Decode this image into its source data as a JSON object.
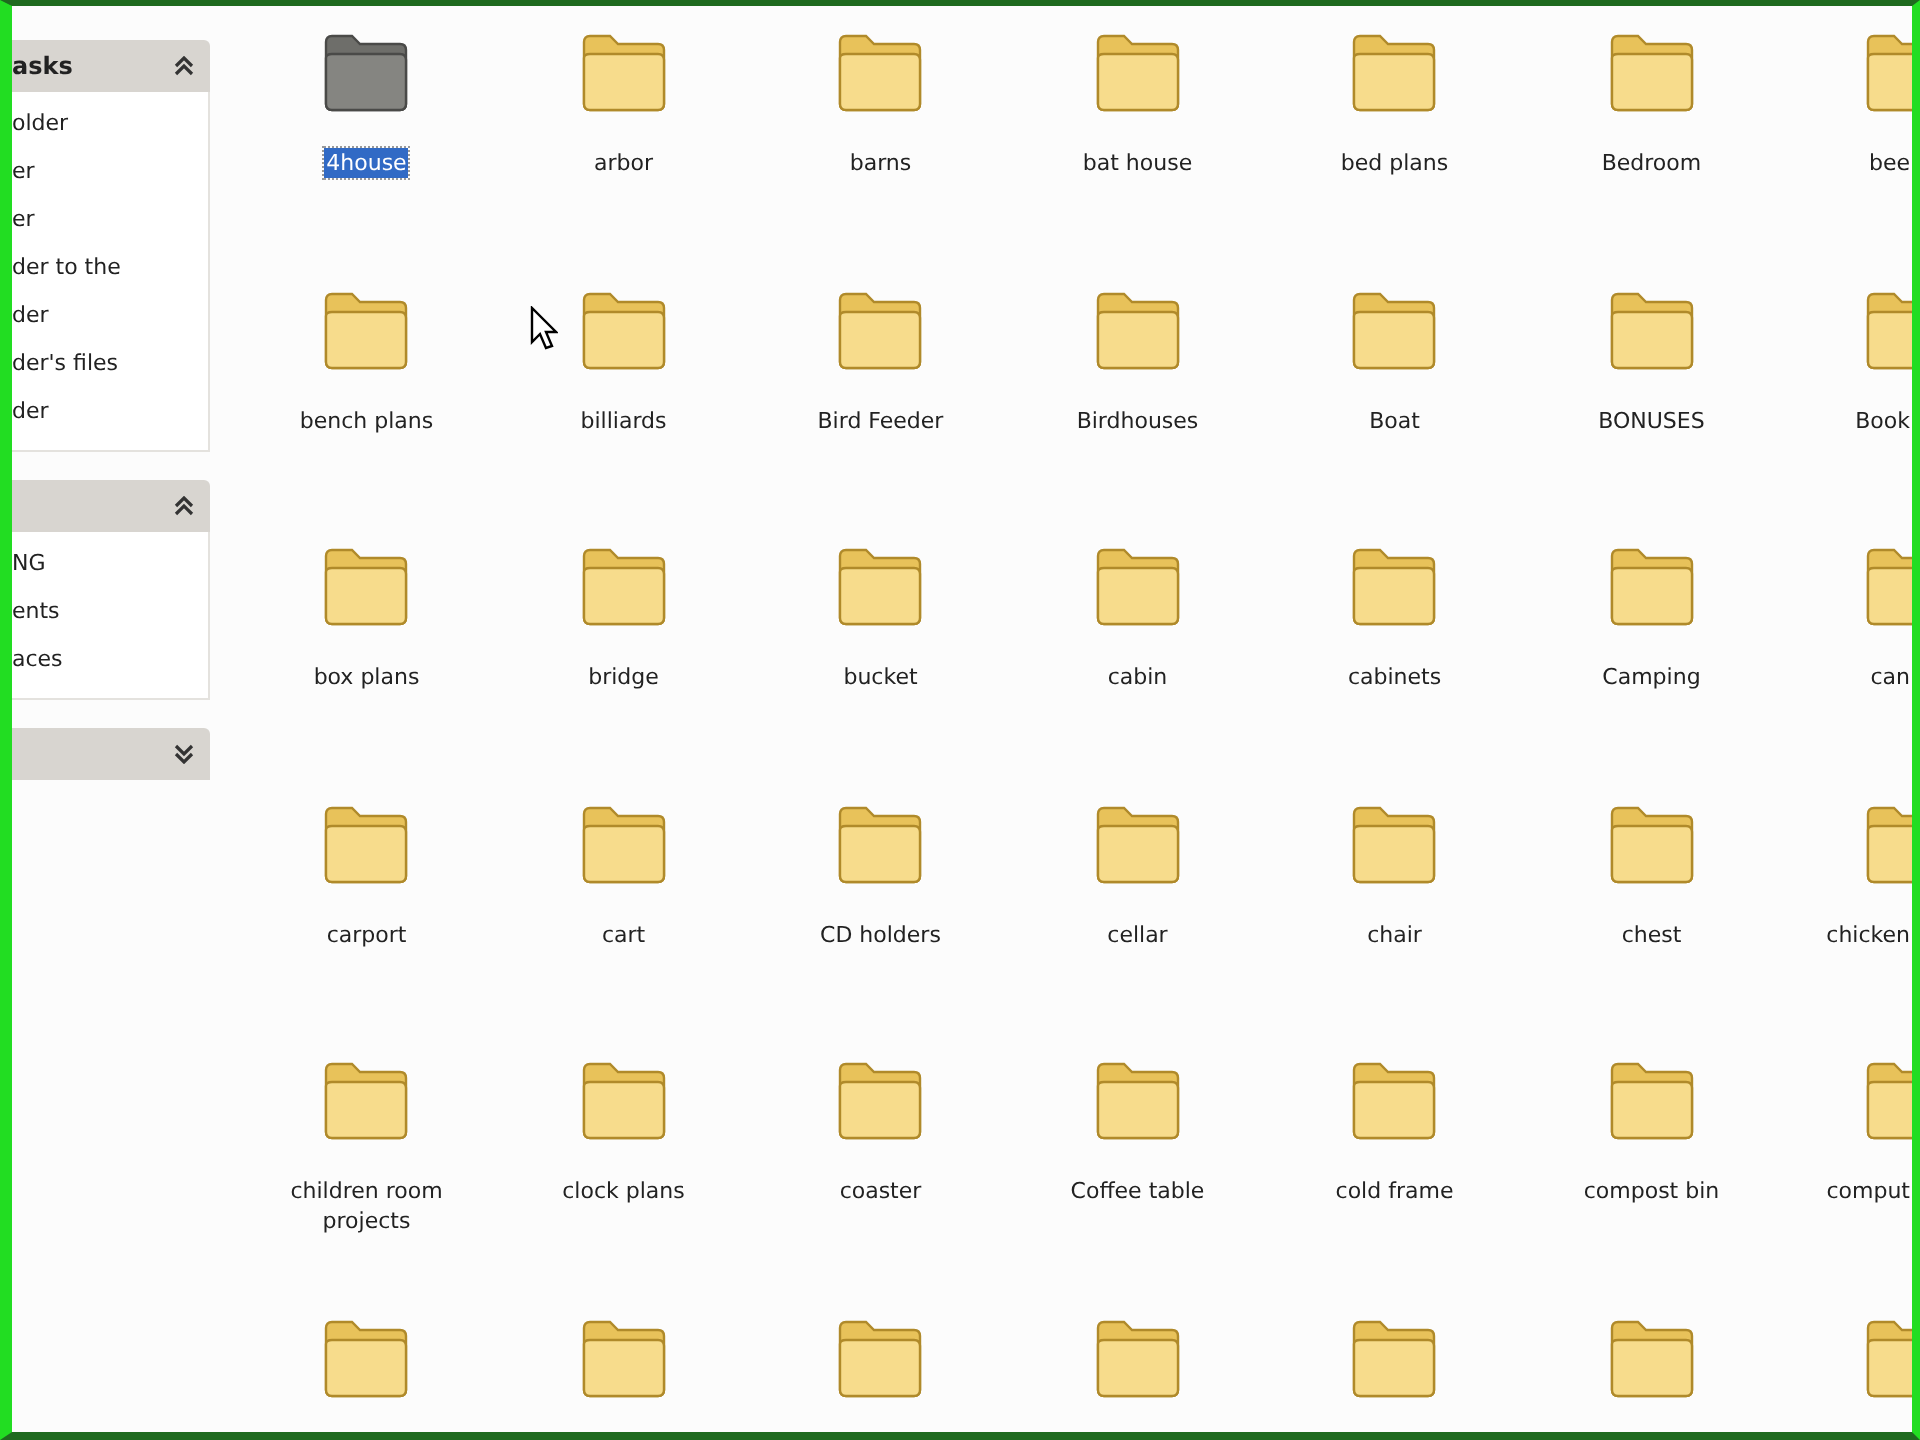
{
  "sidebar": {
    "panels": [
      {
        "title": "asks",
        "expanded": true,
        "items": [
          "older",
          "er",
          "er",
          "der to the",
          "der",
          "der's files",
          "der"
        ]
      },
      {
        "expanded": true,
        "items": [
          "NG",
          "ents",
          "aces"
        ]
      },
      {
        "expanded": false
      }
    ]
  },
  "folders": [
    {
      "label": "4house",
      "selected": true
    },
    {
      "label": "arbor",
      "selected": false
    },
    {
      "label": "barns",
      "selected": false
    },
    {
      "label": "bat house",
      "selected": false
    },
    {
      "label": "bed plans",
      "selected": false
    },
    {
      "label": "Bedroom",
      "selected": false
    },
    {
      "label": "bee",
      "selected": false
    },
    {
      "label": "bench plans",
      "selected": false
    },
    {
      "label": "billiards",
      "selected": false
    },
    {
      "label": "Bird Feeder",
      "selected": false
    },
    {
      "label": "Birdhouses",
      "selected": false
    },
    {
      "label": "Boat",
      "selected": false
    },
    {
      "label": "BONUSES",
      "selected": false
    },
    {
      "label": "Book",
      "selected": false
    },
    {
      "label": "box plans",
      "selected": false
    },
    {
      "label": "bridge",
      "selected": false
    },
    {
      "label": "bucket",
      "selected": false
    },
    {
      "label": "cabin",
      "selected": false
    },
    {
      "label": "cabinets",
      "selected": false
    },
    {
      "label": "Camping",
      "selected": false
    },
    {
      "label": "can",
      "selected": false
    },
    {
      "label": "carport",
      "selected": false
    },
    {
      "label": "cart",
      "selected": false
    },
    {
      "label": "CD holders",
      "selected": false
    },
    {
      "label": "cellar",
      "selected": false
    },
    {
      "label": "chair",
      "selected": false
    },
    {
      "label": "chest",
      "selected": false
    },
    {
      "label": "chicken",
      "selected": false
    },
    {
      "label": "children room projects",
      "selected": false
    },
    {
      "label": "clock plans",
      "selected": false
    },
    {
      "label": "coaster",
      "selected": false
    },
    {
      "label": "Coffee table",
      "selected": false
    },
    {
      "label": "cold frame",
      "selected": false
    },
    {
      "label": "compost bin",
      "selected": false
    },
    {
      "label": "comput",
      "selected": false
    },
    {
      "selected": false
    },
    {
      "selected": false
    },
    {
      "selected": false
    },
    {
      "selected": false
    },
    {
      "selected": false
    },
    {
      "selected": false
    },
    {
      "selected": false
    }
  ]
}
